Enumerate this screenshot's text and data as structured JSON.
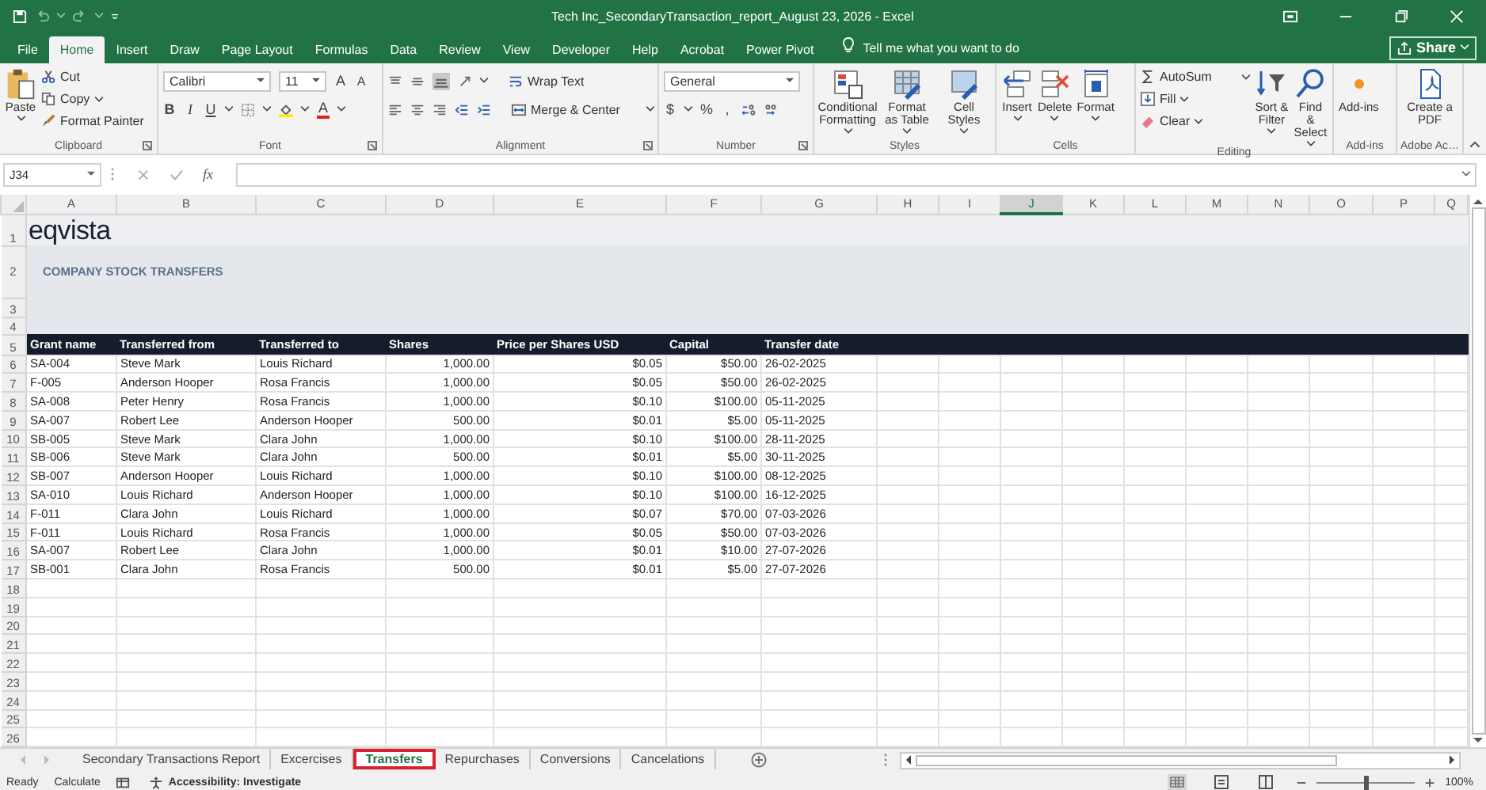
{
  "window": {
    "title": "Tech Inc_SecondaryTransaction_report_August 23, 2026  -  Excel"
  },
  "menu_tabs": [
    {
      "label": "File",
      "selected": false
    },
    {
      "label": "Home",
      "selected": true
    },
    {
      "label": "Insert",
      "selected": false
    },
    {
      "label": "Draw",
      "selected": false
    },
    {
      "label": "Page Layout",
      "selected": false
    },
    {
      "label": "Formulas",
      "selected": false
    },
    {
      "label": "Data",
      "selected": false
    },
    {
      "label": "Review",
      "selected": false
    },
    {
      "label": "View",
      "selected": false
    },
    {
      "label": "Developer",
      "selected": false
    },
    {
      "label": "Help",
      "selected": false
    },
    {
      "label": "Acrobat",
      "selected": false
    },
    {
      "label": "Power Pivot",
      "selected": false
    }
  ],
  "tell_me": "Tell me what you want to do",
  "share": "Share",
  "ribbon": {
    "clipboard": {
      "label": "Clipboard",
      "paste": "Paste",
      "cut": "Cut",
      "copy": "Copy",
      "format_painter": "Format Painter"
    },
    "font": {
      "label": "Font",
      "font_name": "Calibri",
      "font_size": "11",
      "grow": "A",
      "shrink": "A",
      "bold": "B",
      "italic": "I",
      "underline": "U",
      "font_color": "A"
    },
    "alignment": {
      "label": "Alignment",
      "wrap_text": "Wrap Text",
      "merge": "Merge & Center"
    },
    "number": {
      "label": "Number",
      "format": "General",
      "currency": "$",
      "percent": "%",
      "comma": ","
    },
    "styles": {
      "label": "Styles",
      "buttons": [
        "Conditional Formatting",
        "Format as Table",
        "Cell Styles"
      ]
    },
    "cells": {
      "label": "Cells",
      "buttons": [
        "Insert",
        "Delete",
        "Format"
      ]
    },
    "editing": {
      "label": "Editing",
      "autosum": "AutoSum",
      "fill": "Fill",
      "clear": "Clear",
      "sort": "Sort & Filter",
      "find": "Find & Select"
    },
    "addins": {
      "label": "Add-ins",
      "button": "Add-ins"
    },
    "adobe": {
      "label": "Adobe Ac…",
      "button": "Create a PDF"
    }
  },
  "formula_bar": {
    "name_box": "J34",
    "function_label": "fx"
  },
  "sheet": {
    "columns": [
      {
        "letter": "A",
        "selected": false
      },
      {
        "letter": "B",
        "selected": false
      },
      {
        "letter": "C",
        "selected": false
      },
      {
        "letter": "D",
        "selected": false
      },
      {
        "letter": "E",
        "selected": false
      },
      {
        "letter": "F",
        "selected": false
      },
      {
        "letter": "G",
        "selected": false
      },
      {
        "letter": "H",
        "selected": false
      },
      {
        "letter": "I",
        "selected": false
      },
      {
        "letter": "J",
        "selected": true
      },
      {
        "letter": "K",
        "selected": false
      },
      {
        "letter": "L",
        "selected": false
      },
      {
        "letter": "M",
        "selected": false
      },
      {
        "letter": "N",
        "selected": false
      },
      {
        "letter": "O",
        "selected": false
      },
      {
        "letter": "P",
        "selected": false
      },
      {
        "letter": "Q",
        "selected": false
      }
    ],
    "row_numbers": [
      "1",
      "2",
      "3",
      "4",
      "5",
      "6",
      "7",
      "8",
      "9",
      "10",
      "11",
      "12",
      "13",
      "14",
      "15",
      "16",
      "17",
      "18",
      "19",
      "20",
      "21",
      "22",
      "23",
      "24",
      "25",
      "26"
    ],
    "logo": "eqvista",
    "report_title": "COMPANY STOCK TRANSFERS"
  },
  "table": {
    "columns": [
      "Grant name",
      "Transferred from",
      "Transferred to",
      "Shares",
      "Price per Shares USD",
      "Capital",
      "Transfer date"
    ],
    "rows": [
      [
        "SA-004",
        "Steve Mark",
        "Louis Richard",
        "1,000.00",
        "$0.05",
        "$50.00",
        "26-02-2025"
      ],
      [
        "F-005",
        "Anderson Hooper",
        "Rosa Francis",
        "1,000.00",
        "$0.05",
        "$50.00",
        "26-02-2025"
      ],
      [
        "SA-008",
        "Peter Henry",
        "Rosa Francis",
        "1,000.00",
        "$0.10",
        "$100.00",
        "05-11-2025"
      ],
      [
        "SA-007",
        "Robert Lee",
        "Anderson Hooper",
        "500.00",
        "$0.01",
        "$5.00",
        "05-11-2025"
      ],
      [
        "SB-005",
        "Steve Mark",
        "Clara John",
        "1,000.00",
        "$0.10",
        "$100.00",
        "28-11-2025"
      ],
      [
        "SB-006",
        "Steve Mark",
        "Clara John",
        "500.00",
        "$0.01",
        "$5.00",
        "30-11-2025"
      ],
      [
        "SB-007",
        "Anderson Hooper",
        "Louis Richard",
        "1,000.00",
        "$0.10",
        "$100.00",
        "08-12-2025"
      ],
      [
        "SA-010",
        "Louis Richard",
        "Anderson Hooper",
        "1,000.00",
        "$0.10",
        "$100.00",
        "16-12-2025"
      ],
      [
        "F-011",
        "Clara John",
        "Louis Richard",
        "1,000.00",
        "$0.07",
        "$70.00",
        "07-03-2026"
      ],
      [
        "F-011",
        "Louis Richard",
        "Rosa Francis",
        "1,000.00",
        "$0.05",
        "$50.00",
        "07-03-2026"
      ],
      [
        "SA-007",
        "Robert Lee",
        "Clara John",
        "1,000.00",
        "$0.01",
        "$10.00",
        "27-07-2026"
      ],
      [
        "SB-001",
        "Clara John",
        "Rosa Francis",
        "500.00",
        "$0.01",
        "$5.00",
        "27-07-2026"
      ]
    ]
  },
  "sheet_tabs": [
    {
      "label": "Secondary Transactions Report",
      "selected": false
    },
    {
      "label": "Excercises",
      "selected": false
    },
    {
      "label": "Transfers",
      "selected": true
    },
    {
      "label": "Repurchases",
      "selected": false
    },
    {
      "label": "Conversions",
      "selected": false
    },
    {
      "label": "Cancelations",
      "selected": false
    }
  ],
  "status_bar": {
    "ready": "Ready",
    "calculate": "Calculate",
    "accessibility": "Accessibility: Investigate",
    "zoom": "100%",
    "zoom_slider": {
      "level": 0.5
    }
  }
}
